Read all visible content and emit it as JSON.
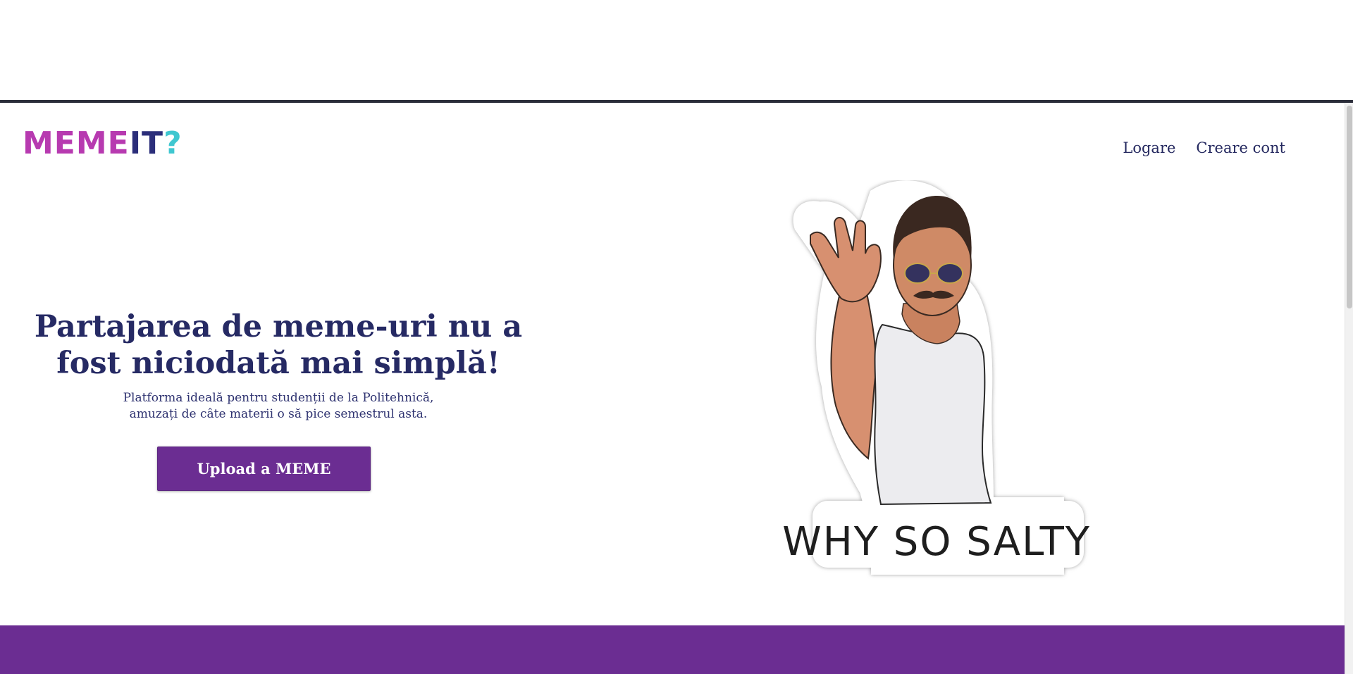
{
  "header": {
    "logo": {
      "part1": "MEME",
      "part2": "IT",
      "part3": "?"
    },
    "nav": {
      "login": "Logare",
      "signup": "Creare cont"
    }
  },
  "hero": {
    "title": "Partajarea de meme-uri nu a fost niciodată mai simplă!",
    "subtitle_line1": "Platforma ideală pentru studenții de la Politehnică,",
    "subtitle_line2": "amuzați de câte materii o să pice semestrul asta.",
    "upload_button": "Upload a MEME"
  },
  "sticker": {
    "caption": "WHY SO SALTY?"
  },
  "colors": {
    "brand_purple": "#6b2d92",
    "logo_magenta": "#b73ab0",
    "logo_navy": "#2b2e7a",
    "logo_cyan": "#3fc7d0",
    "text_navy": "#262a64"
  }
}
